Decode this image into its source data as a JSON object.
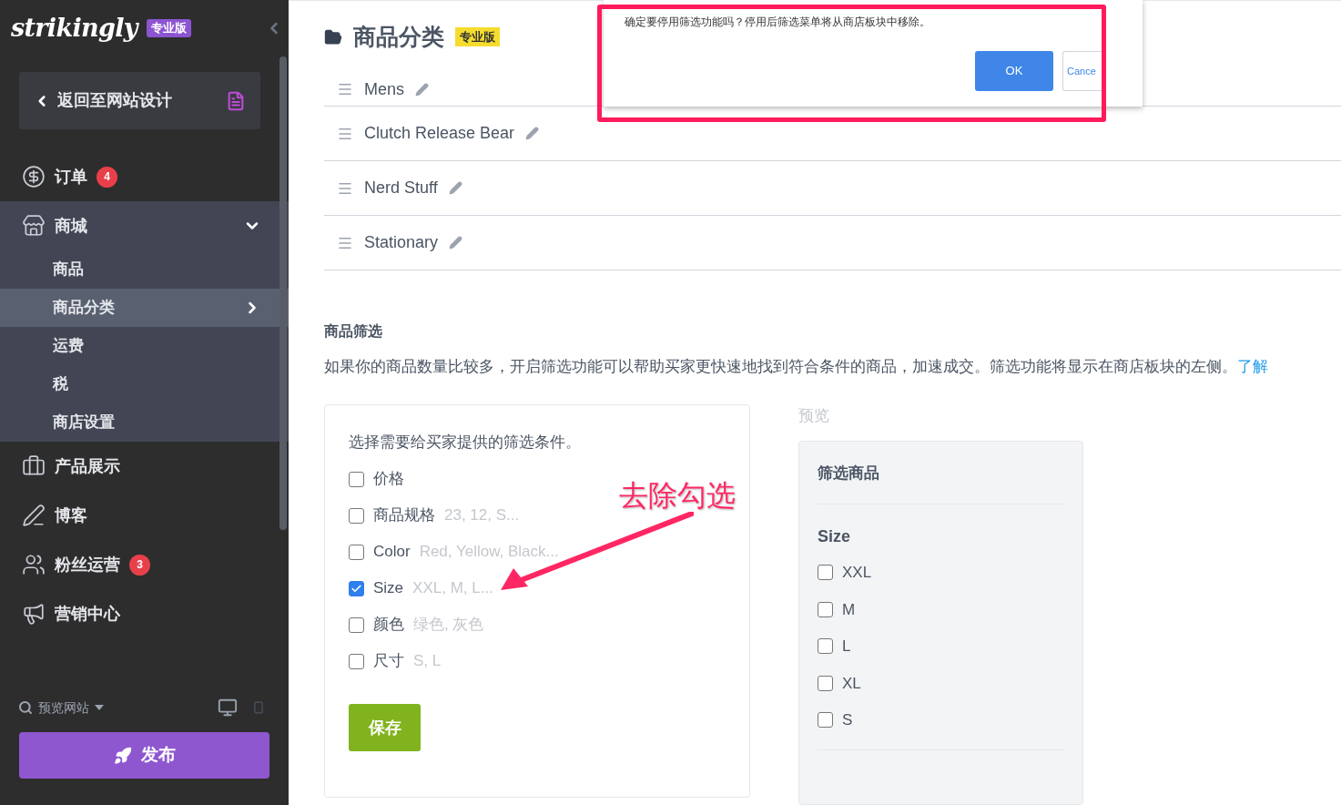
{
  "sidebar": {
    "logo": "strikingly",
    "plan_badge": "专业版",
    "back_button": "返回至网站设计",
    "nav": [
      {
        "label": "订单",
        "badge": "4",
        "selected": false,
        "expanded": false
      },
      {
        "label": "商城",
        "selected": false,
        "expanded": true,
        "children": [
          {
            "label": "商品",
            "selected": false
          },
          {
            "label": "商品分类",
            "selected": true
          },
          {
            "label": "运费",
            "selected": false
          },
          {
            "label": "税",
            "selected": false
          },
          {
            "label": "商店设置",
            "selected": false
          }
        ]
      },
      {
        "label": "产品展示",
        "selected": false,
        "expanded": false
      },
      {
        "label": "博客",
        "selected": false,
        "expanded": false
      },
      {
        "label": "粉丝运营",
        "badge": "3",
        "selected": false,
        "expanded": false
      },
      {
        "label": "营销中心",
        "selected": false,
        "expanded": false
      }
    ],
    "preview": "预览网站",
    "publish_button": "发布"
  },
  "header": {
    "title": "商品分类",
    "badge": "专业版"
  },
  "categories": [
    {
      "name": "Mens"
    },
    {
      "name": "Clutch Release Bear"
    },
    {
      "name": "Nerd Stuff"
    },
    {
      "name": "Stationary"
    }
  ],
  "filter_section": {
    "title": "商品筛选",
    "description": "如果你的商品数量比较多，开启筛选功能可以帮助买家更快速地找到符合条件的商品，加速成交。筛选功能将显示在商店板块的左侧。",
    "link": "了解",
    "prompt": "选择需要给买家提供的筛选条件。",
    "options": [
      {
        "label": "价格",
        "checked": false
      },
      {
        "label": "商品规格",
        "hint": "23, 12, S...",
        "checked": false
      },
      {
        "label": "Color",
        "hint": "Red, Yellow, Black...",
        "checked": false
      },
      {
        "label": "Size",
        "hint": "XXL, M, L...",
        "checked": true
      },
      {
        "label": "颜色",
        "hint": "绿色, 灰色",
        "checked": false
      },
      {
        "label": "尺寸",
        "hint": "S, L",
        "checked": false
      }
    ],
    "save_button": "保存"
  },
  "preview": {
    "label": "预览",
    "title": "筛选商品",
    "group": "Size",
    "options": [
      {
        "label": "XXL",
        "checked": false
      },
      {
        "label": "M",
        "checked": false
      },
      {
        "label": "L",
        "checked": false
      },
      {
        "label": "XL",
        "checked": false
      },
      {
        "label": "S",
        "checked": false
      }
    ]
  },
  "dialog": {
    "message": "确定要停用筛选功能吗？停用后筛选菜单将从商店板块中移除。",
    "ok_button": "OK",
    "cancel_button": "Cance"
  },
  "annotation": {
    "text": "去除勾选"
  }
}
